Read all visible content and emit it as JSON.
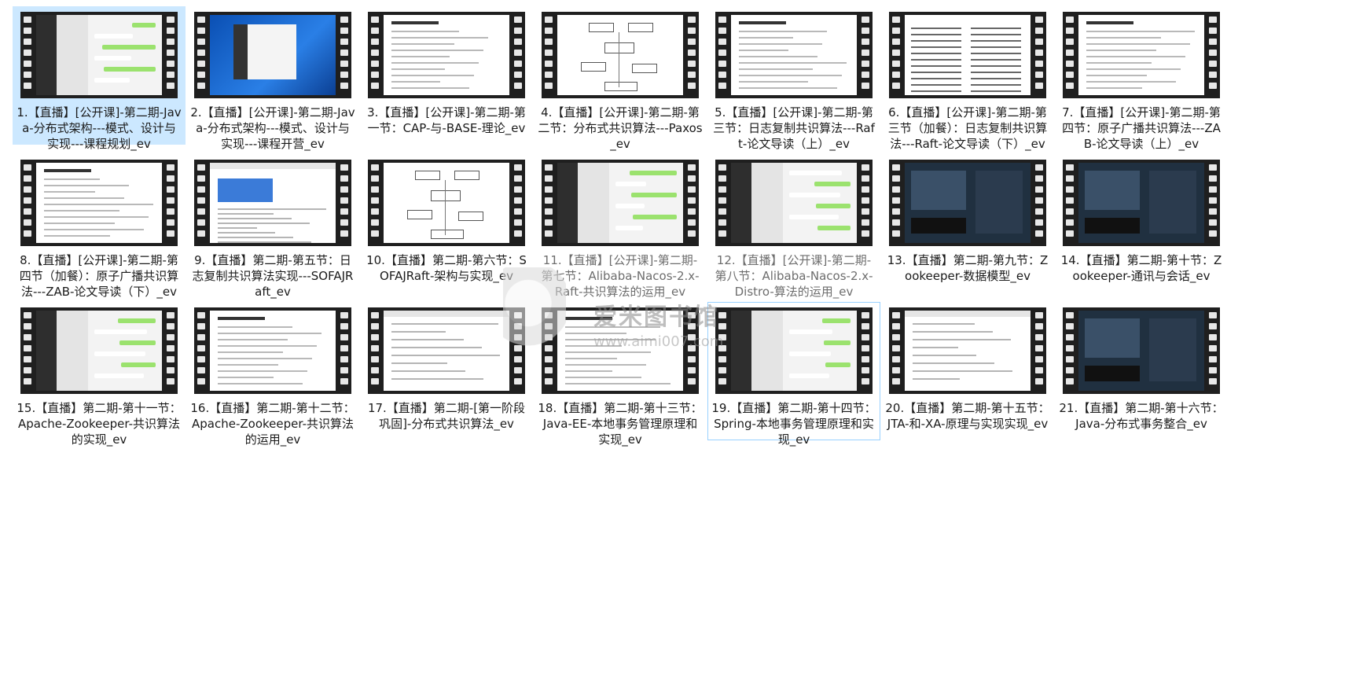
{
  "items": [
    {
      "label": "1.【直播】[公开课]-第二期-Java-分布式架构---模式、设计与实现---课程规划_ev",
      "thumb": "chat",
      "selected": true
    },
    {
      "label": "2.【直播】[公开课]-第二期-Java-分布式架构---模式、设计与实现---课程开营_ev",
      "thumb": "desk"
    },
    {
      "label": "3.【直播】[公开课]-第二期-第一节：CAP-与-BASE-理论_ev",
      "thumb": "doc",
      "caption": "第一节：CAP 与 BASE 理论"
    },
    {
      "label": "4.【直播】[公开课]-第二期-第二节：分布式共识算法---Paxos_ev",
      "thumb": "diag"
    },
    {
      "label": "5.【直播】[公开课]-第二期-第三节：日志复制共识算法---Raft-论文导读（上）_ev",
      "thumb": "doc",
      "caption": "第三节：复制日志算法 - RAFT"
    },
    {
      "label": "6.【直播】[公开课]-第二期-第三节（加餐）：日志复制共识算法---Raft-论文导读（下）_ev",
      "thumb": "paper",
      "caption": "In Search of an Understandable Consensus Algorithm"
    },
    {
      "label": "7.【直播】[公开课]-第二期-第四节：原子广播共识算法---ZAB-论文导读（上）_ev",
      "thumb": "doc",
      "caption": "第四节：原子广播协议 - ZAB"
    },
    {
      "label": "8.【直播】[公开课]-第二期-第四节（加餐）：原子广播共识算法---ZAB-论文导读（下）_ev",
      "thumb": "doc",
      "caption": "第四节：原子广播协议 - ZAB"
    },
    {
      "label": "9.【直播】第二期-第五节：日志复制共识算法实现---SOFAJRaft_ev",
      "thumb": "web"
    },
    {
      "label": "10.【直播】第二期-第六节：SOFAJRaft-架构与实现_ev",
      "thumb": "diag",
      "caption": "第六节：SOFAJRaft 架构与实现"
    },
    {
      "label": "11.【直播】[公开课]-第二期-第七节：Alibaba-Nacos-2.x-Raft-共识算法的运用_ev",
      "thumb": "chat",
      "dim": true
    },
    {
      "label": "12.【直播】[公开课]-第二期-第八节：Alibaba-Nacos-2.x-Distro-算法的运用_ev",
      "thumb": "chat",
      "dim": true
    },
    {
      "label": "13.【直播】第二期-第九节：Zookeeper-数据模型_ev",
      "thumb": "dark"
    },
    {
      "label": "14.【直播】第二期-第十节：Zookeeper-通讯与会话_ev",
      "thumb": "dark"
    },
    {
      "label": "15.【直播】第二期-第十一节：Apache-Zookeeper-共识算法的实现_ev",
      "thumb": "chat"
    },
    {
      "label": "16.【直播】第二期-第十二节：Apache-Zookeeper-共识算法的运用_ev",
      "thumb": "doc",
      "caption": "第十二节：Apache Zookeeper 共识算法的运用"
    },
    {
      "label": "17.【直播】第二期-[第一阶段巩固]-分布式共识算法_ev",
      "thumb": "web"
    },
    {
      "label": "18.【直播】第二期-第十三节：Java-EE-本地事务管理原理和实现_ev",
      "thumb": "doc"
    },
    {
      "label": "19.【直播】第二期-第十四节：Spring-本地事务管理原理和实现_ev",
      "thumb": "chat",
      "hover": true
    },
    {
      "label": "20.【直播】第二期-第十五节：JTA-和-XA-原理与实现实现_ev",
      "thumb": "web"
    },
    {
      "label": "21.【直播】第二期-第十六节：Java-分布式事务整合_ev",
      "thumb": "dark"
    }
  ],
  "watermark": {
    "title": "爱米图书馆",
    "url": "www.aimi007.com"
  }
}
